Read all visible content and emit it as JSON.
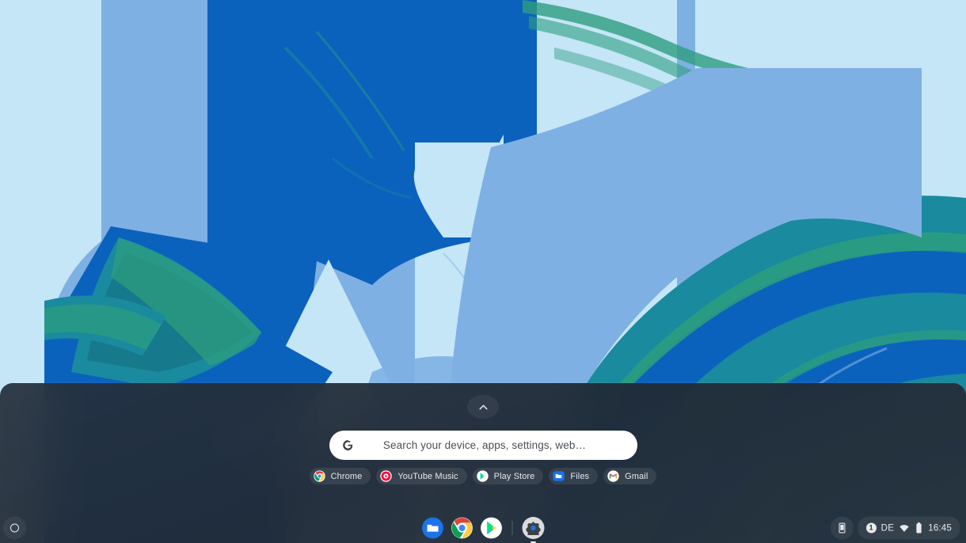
{
  "wallpaper": {
    "name": "abstract-blue-marble-wallpaper",
    "colors": {
      "light_blue": "#c4e6f7",
      "medium_blue": "#7fb0e3",
      "deep_blue": "#0b62bd",
      "teal": "#1a8a9e",
      "teal_dark": "#16798c",
      "green_swirl": "#2e9e7e"
    }
  },
  "launcher": {
    "expand_handle_icon": "chevron-up-icon",
    "search": {
      "placeholder": "Search your device, apps, settings, web…",
      "value": "",
      "logo_icon": "google-g-icon"
    },
    "chips": [
      {
        "label": "Chrome",
        "icon": "chrome-icon"
      },
      {
        "label": "YouTube Music",
        "icon": "youtube-music-icon"
      },
      {
        "label": "Play Store",
        "icon": "play-store-icon"
      },
      {
        "label": "Files",
        "icon": "files-folder-icon"
      },
      {
        "label": "Gmail",
        "icon": "gmail-icon"
      }
    ]
  },
  "shelf": {
    "launcher_button_icon": "launcher-circle-icon",
    "apps": [
      {
        "label": "Files",
        "icon": "files-folder-icon",
        "active": false,
        "running": false
      },
      {
        "label": "Chrome",
        "icon": "chrome-icon",
        "active": false,
        "running": false
      },
      {
        "label": "Play Store",
        "icon": "play-store-icon",
        "active": false,
        "running": false
      },
      {
        "label": "Settings",
        "icon": "settings-gear-icon",
        "active": true,
        "running": true
      }
    ],
    "status": {
      "phone_hub_icon": "phone-hub-icon",
      "notification_count": "1",
      "locale": "DE",
      "wifi_icon": "wifi-icon",
      "battery_icon": "battery-icon",
      "time": "16:45"
    }
  }
}
